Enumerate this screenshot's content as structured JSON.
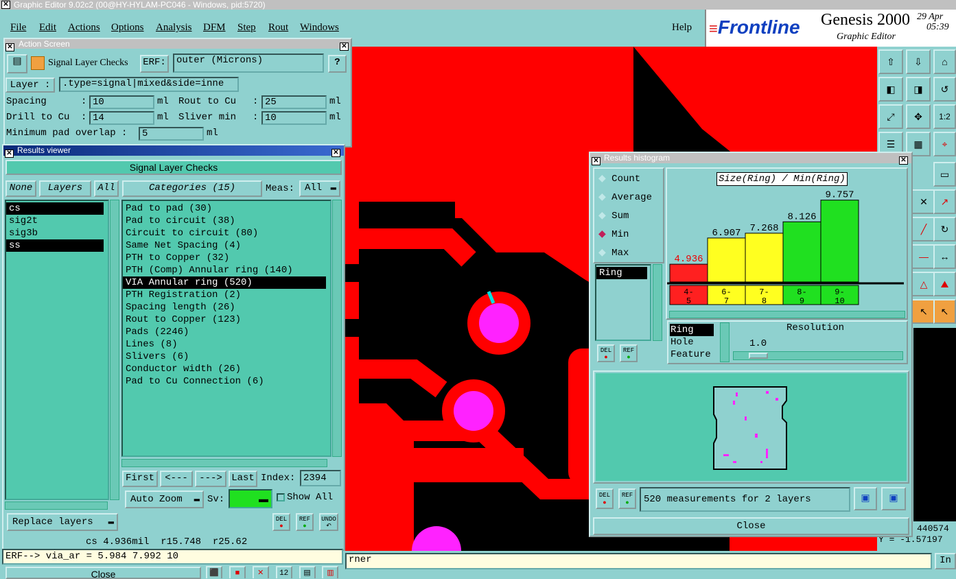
{
  "app": {
    "title": "Graphic Editor 9.02c2 (00@HY-HYLAM-PC046 - Windows, pid:5720)"
  },
  "menu": {
    "items": [
      "File",
      "Edit",
      "Actions",
      "Options",
      "Analysis",
      "DFM",
      "Step",
      "Rout",
      "Windows"
    ],
    "help": "Help"
  },
  "brand": {
    "logo": "Frontline",
    "product": "Genesis 2000",
    "subtitle": "Graphic Editor",
    "date": "29 Apr",
    "time": "05:39"
  },
  "action_screen": {
    "title": "Action Screen",
    "check_name": "Signal Layer Checks",
    "erf_label": "ERF:",
    "erf_value": "outer (Microns)",
    "help": "?",
    "layer_label": "Layer :",
    "layer_value": ".type=signal|mixed&side=inne",
    "spacing_label": "Spacing",
    "spacing_value": "10",
    "drill_label": "Drill to Cu",
    "drill_value": "14",
    "rout_label": "Rout to Cu",
    "rout_value": "25",
    "sliver_label": "Sliver min",
    "sliver_value": "10",
    "min_pad_label": "Minimum pad overlap :",
    "min_pad_value": "5",
    "unit": "ml"
  },
  "results_viewer": {
    "title": "Results viewer",
    "header": "Signal Layer Checks",
    "none_btn": "None",
    "layers_btn": "Layers",
    "all_btn": "All",
    "categories_label": "Categories (15)",
    "meas_label": "Meas:",
    "meas_value": "All",
    "layers": [
      "cs",
      "sig2t",
      "sig3b",
      "ss"
    ],
    "categories": [
      "Pad to pad (30)",
      "Pad to circuit (38)",
      "Circuit to circuit (80)",
      "Same Net Spacing (4)",
      "PTH to Copper (32)",
      "PTH (Comp) Annular ring (140)",
      "VIA Annular ring (520)",
      "PTH Registration (2)",
      "Spacing length (26)",
      "Rout to Copper (123)",
      "Pads (2246)",
      "Lines (8)",
      "Slivers (6)",
      "Conductor width (26)",
      "Pad to Cu Connection (6)"
    ],
    "first": "First",
    "prev": "<---",
    "next": "--->",
    "last": "Last",
    "index_label": "Index:",
    "index_value": "2394",
    "auto_zoom": "Auto Zoom",
    "sv_label": "Sv:",
    "show_all": "Show All",
    "replace_layers": "Replace layers",
    "del": "DEL",
    "ref": "REF",
    "undo": "UNDO",
    "status": "cs 4.936mil  r15.748  r25.62"
  },
  "erf_line": "ERF--> via_ar = 5.984 7.992 10",
  "close": "Close",
  "corner_text": "rner",
  "histogram": {
    "title": "Results histogram",
    "options": [
      "Count",
      "Average",
      "Sum",
      "Min",
      "Max"
    ],
    "selected": "Min",
    "list_item": "Ring",
    "chart_title": "Size(Ring) / Min(Ring)",
    "types": [
      "Ring",
      "Hole",
      "Feature"
    ],
    "resolution_label": "Resolution",
    "resolution_value": "1.0",
    "summary": "520 measurements for 2 layers",
    "close": "Close",
    "del": "DEL",
    "ref": "REF"
  },
  "chart_data": {
    "type": "bar",
    "title": "Size(Ring) / Min(Ring)",
    "categories": [
      "4-5",
      "6-7",
      "7-8",
      "8-9",
      "9-10"
    ],
    "values": [
      4.936,
      6.907,
      7.268,
      8.126,
      9.757
    ],
    "colors": [
      "#ff2020",
      "#ffff20",
      "#ffff20",
      "#20e020",
      "#20e020"
    ]
  },
  "coords": {
    "x": "440574",
    "y": "Y = -1.57197"
  },
  "ine": "In"
}
